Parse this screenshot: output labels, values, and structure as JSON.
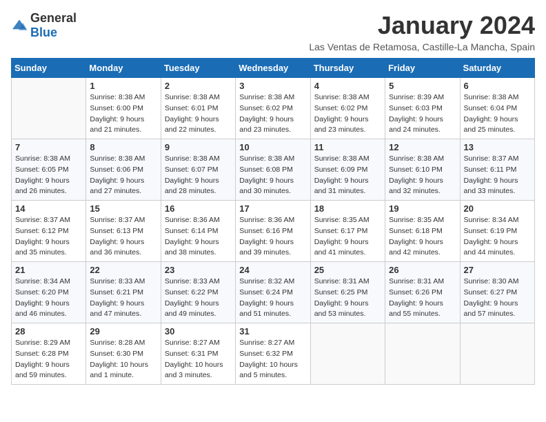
{
  "header": {
    "logo_general": "General",
    "logo_blue": "Blue",
    "month_title": "January 2024",
    "location": "Las Ventas de Retamosa, Castille-La Mancha, Spain"
  },
  "weekdays": [
    "Sunday",
    "Monday",
    "Tuesday",
    "Wednesday",
    "Thursday",
    "Friday",
    "Saturday"
  ],
  "weeks": [
    [
      {
        "day": "",
        "sunrise": "",
        "sunset": "",
        "daylight": ""
      },
      {
        "day": "1",
        "sunrise": "Sunrise: 8:38 AM",
        "sunset": "Sunset: 6:00 PM",
        "daylight": "Daylight: 9 hours and 21 minutes."
      },
      {
        "day": "2",
        "sunrise": "Sunrise: 8:38 AM",
        "sunset": "Sunset: 6:01 PM",
        "daylight": "Daylight: 9 hours and 22 minutes."
      },
      {
        "day": "3",
        "sunrise": "Sunrise: 8:38 AM",
        "sunset": "Sunset: 6:02 PM",
        "daylight": "Daylight: 9 hours and 23 minutes."
      },
      {
        "day": "4",
        "sunrise": "Sunrise: 8:38 AM",
        "sunset": "Sunset: 6:02 PM",
        "daylight": "Daylight: 9 hours and 23 minutes."
      },
      {
        "day": "5",
        "sunrise": "Sunrise: 8:39 AM",
        "sunset": "Sunset: 6:03 PM",
        "daylight": "Daylight: 9 hours and 24 minutes."
      },
      {
        "day": "6",
        "sunrise": "Sunrise: 8:38 AM",
        "sunset": "Sunset: 6:04 PM",
        "daylight": "Daylight: 9 hours and 25 minutes."
      }
    ],
    [
      {
        "day": "7",
        "sunrise": "Sunrise: 8:38 AM",
        "sunset": "Sunset: 6:05 PM",
        "daylight": "Daylight: 9 hours and 26 minutes."
      },
      {
        "day": "8",
        "sunrise": "Sunrise: 8:38 AM",
        "sunset": "Sunset: 6:06 PM",
        "daylight": "Daylight: 9 hours and 27 minutes."
      },
      {
        "day": "9",
        "sunrise": "Sunrise: 8:38 AM",
        "sunset": "Sunset: 6:07 PM",
        "daylight": "Daylight: 9 hours and 28 minutes."
      },
      {
        "day": "10",
        "sunrise": "Sunrise: 8:38 AM",
        "sunset": "Sunset: 6:08 PM",
        "daylight": "Daylight: 9 hours and 30 minutes."
      },
      {
        "day": "11",
        "sunrise": "Sunrise: 8:38 AM",
        "sunset": "Sunset: 6:09 PM",
        "daylight": "Daylight: 9 hours and 31 minutes."
      },
      {
        "day": "12",
        "sunrise": "Sunrise: 8:38 AM",
        "sunset": "Sunset: 6:10 PM",
        "daylight": "Daylight: 9 hours and 32 minutes."
      },
      {
        "day": "13",
        "sunrise": "Sunrise: 8:37 AM",
        "sunset": "Sunset: 6:11 PM",
        "daylight": "Daylight: 9 hours and 33 minutes."
      }
    ],
    [
      {
        "day": "14",
        "sunrise": "Sunrise: 8:37 AM",
        "sunset": "Sunset: 6:12 PM",
        "daylight": "Daylight: 9 hours and 35 minutes."
      },
      {
        "day": "15",
        "sunrise": "Sunrise: 8:37 AM",
        "sunset": "Sunset: 6:13 PM",
        "daylight": "Daylight: 9 hours and 36 minutes."
      },
      {
        "day": "16",
        "sunrise": "Sunrise: 8:36 AM",
        "sunset": "Sunset: 6:14 PM",
        "daylight": "Daylight: 9 hours and 38 minutes."
      },
      {
        "day": "17",
        "sunrise": "Sunrise: 8:36 AM",
        "sunset": "Sunset: 6:16 PM",
        "daylight": "Daylight: 9 hours and 39 minutes."
      },
      {
        "day": "18",
        "sunrise": "Sunrise: 8:35 AM",
        "sunset": "Sunset: 6:17 PM",
        "daylight": "Daylight: 9 hours and 41 minutes."
      },
      {
        "day": "19",
        "sunrise": "Sunrise: 8:35 AM",
        "sunset": "Sunset: 6:18 PM",
        "daylight": "Daylight: 9 hours and 42 minutes."
      },
      {
        "day": "20",
        "sunrise": "Sunrise: 8:34 AM",
        "sunset": "Sunset: 6:19 PM",
        "daylight": "Daylight: 9 hours and 44 minutes."
      }
    ],
    [
      {
        "day": "21",
        "sunrise": "Sunrise: 8:34 AM",
        "sunset": "Sunset: 6:20 PM",
        "daylight": "Daylight: 9 hours and 46 minutes."
      },
      {
        "day": "22",
        "sunrise": "Sunrise: 8:33 AM",
        "sunset": "Sunset: 6:21 PM",
        "daylight": "Daylight: 9 hours and 47 minutes."
      },
      {
        "day": "23",
        "sunrise": "Sunrise: 8:33 AM",
        "sunset": "Sunset: 6:22 PM",
        "daylight": "Daylight: 9 hours and 49 minutes."
      },
      {
        "day": "24",
        "sunrise": "Sunrise: 8:32 AM",
        "sunset": "Sunset: 6:24 PM",
        "daylight": "Daylight: 9 hours and 51 minutes."
      },
      {
        "day": "25",
        "sunrise": "Sunrise: 8:31 AM",
        "sunset": "Sunset: 6:25 PM",
        "daylight": "Daylight: 9 hours and 53 minutes."
      },
      {
        "day": "26",
        "sunrise": "Sunrise: 8:31 AM",
        "sunset": "Sunset: 6:26 PM",
        "daylight": "Daylight: 9 hours and 55 minutes."
      },
      {
        "day": "27",
        "sunrise": "Sunrise: 8:30 AM",
        "sunset": "Sunset: 6:27 PM",
        "daylight": "Daylight: 9 hours and 57 minutes."
      }
    ],
    [
      {
        "day": "28",
        "sunrise": "Sunrise: 8:29 AM",
        "sunset": "Sunset: 6:28 PM",
        "daylight": "Daylight: 9 hours and 59 minutes."
      },
      {
        "day": "29",
        "sunrise": "Sunrise: 8:28 AM",
        "sunset": "Sunset: 6:30 PM",
        "daylight": "Daylight: 10 hours and 1 minute."
      },
      {
        "day": "30",
        "sunrise": "Sunrise: 8:27 AM",
        "sunset": "Sunset: 6:31 PM",
        "daylight": "Daylight: 10 hours and 3 minutes."
      },
      {
        "day": "31",
        "sunrise": "Sunrise: 8:27 AM",
        "sunset": "Sunset: 6:32 PM",
        "daylight": "Daylight: 10 hours and 5 minutes."
      },
      {
        "day": "",
        "sunrise": "",
        "sunset": "",
        "daylight": ""
      },
      {
        "day": "",
        "sunrise": "",
        "sunset": "",
        "daylight": ""
      },
      {
        "day": "",
        "sunrise": "",
        "sunset": "",
        "daylight": ""
      }
    ]
  ]
}
